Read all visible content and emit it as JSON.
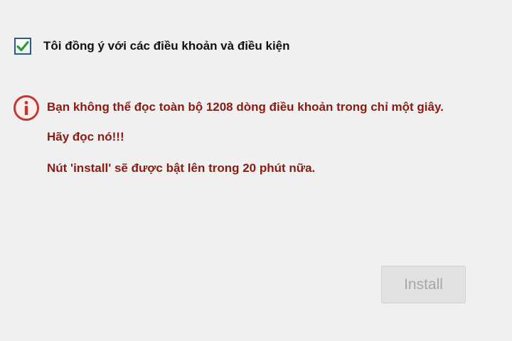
{
  "agreement": {
    "label": "Tôi đồng ý với các điều khoản và điều kiện",
    "checked": true
  },
  "warning": {
    "icon": "info-icon",
    "line1": "Bạn không thể đọc toàn bộ 1208 dòng điều khoản trong chỉ một giây.",
    "line2": "Hãy đọc nó!!!",
    "line3": "Nút 'install' sẽ được bật lên trong 20 phút nữa."
  },
  "install_button": {
    "label": "Install",
    "enabled": false
  },
  "colors": {
    "background": "#f0f0f0",
    "warning_text": "#8b1a10",
    "warning_icon": "#c0392b",
    "checkmark": "#2f9a2f",
    "checkbox_border": "#2d5a8c",
    "button_disabled_text": "#a6a6a6"
  }
}
